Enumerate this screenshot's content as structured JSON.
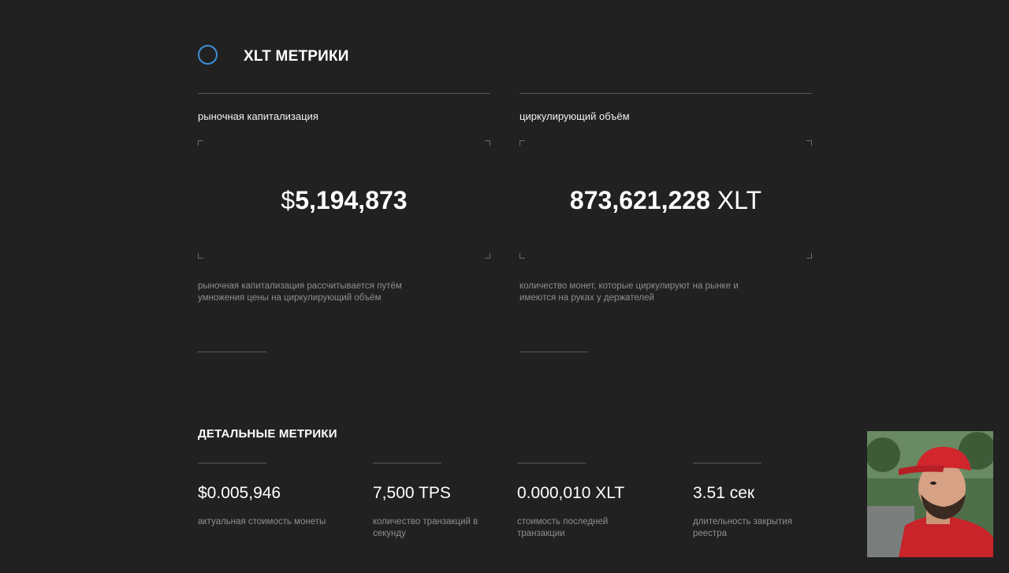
{
  "header": {
    "title": "XLT МЕТРИКИ"
  },
  "metrics": {
    "market_cap": {
      "label": "рыночная капитализация",
      "symbol": "$",
      "value": "5,194,873",
      "description": "рыночная капитализация рассчитывается путём умножения цены на циркулирующий объём"
    },
    "circulating": {
      "label": "циркулирующий объём",
      "value": "873,621,228",
      "unit": "XLT",
      "description": "количество монет, которые циркулируют на рынке и имеются на руках у держателей"
    }
  },
  "details": {
    "title": "ДЕТАЛЬНЫЕ МЕТРИКИ",
    "items": [
      {
        "value": "$0.005,946",
        "label": "актуальная стоимость монеты"
      },
      {
        "value": "7,500 TPS",
        "label": "количество транзакций в секунду"
      },
      {
        "value": "0.000,010 XLT",
        "label": "стоимость последней транзакции"
      },
      {
        "value": "3.51 сек",
        "label": "длительность закрытия реестра"
      }
    ]
  },
  "colors": {
    "background": "#212121",
    "accent": "#3f8fd6",
    "muted_text": "#8e8e8e",
    "rule": "#5b5b5b"
  },
  "webcam": {
    "icon": "webcam-person-icon"
  }
}
